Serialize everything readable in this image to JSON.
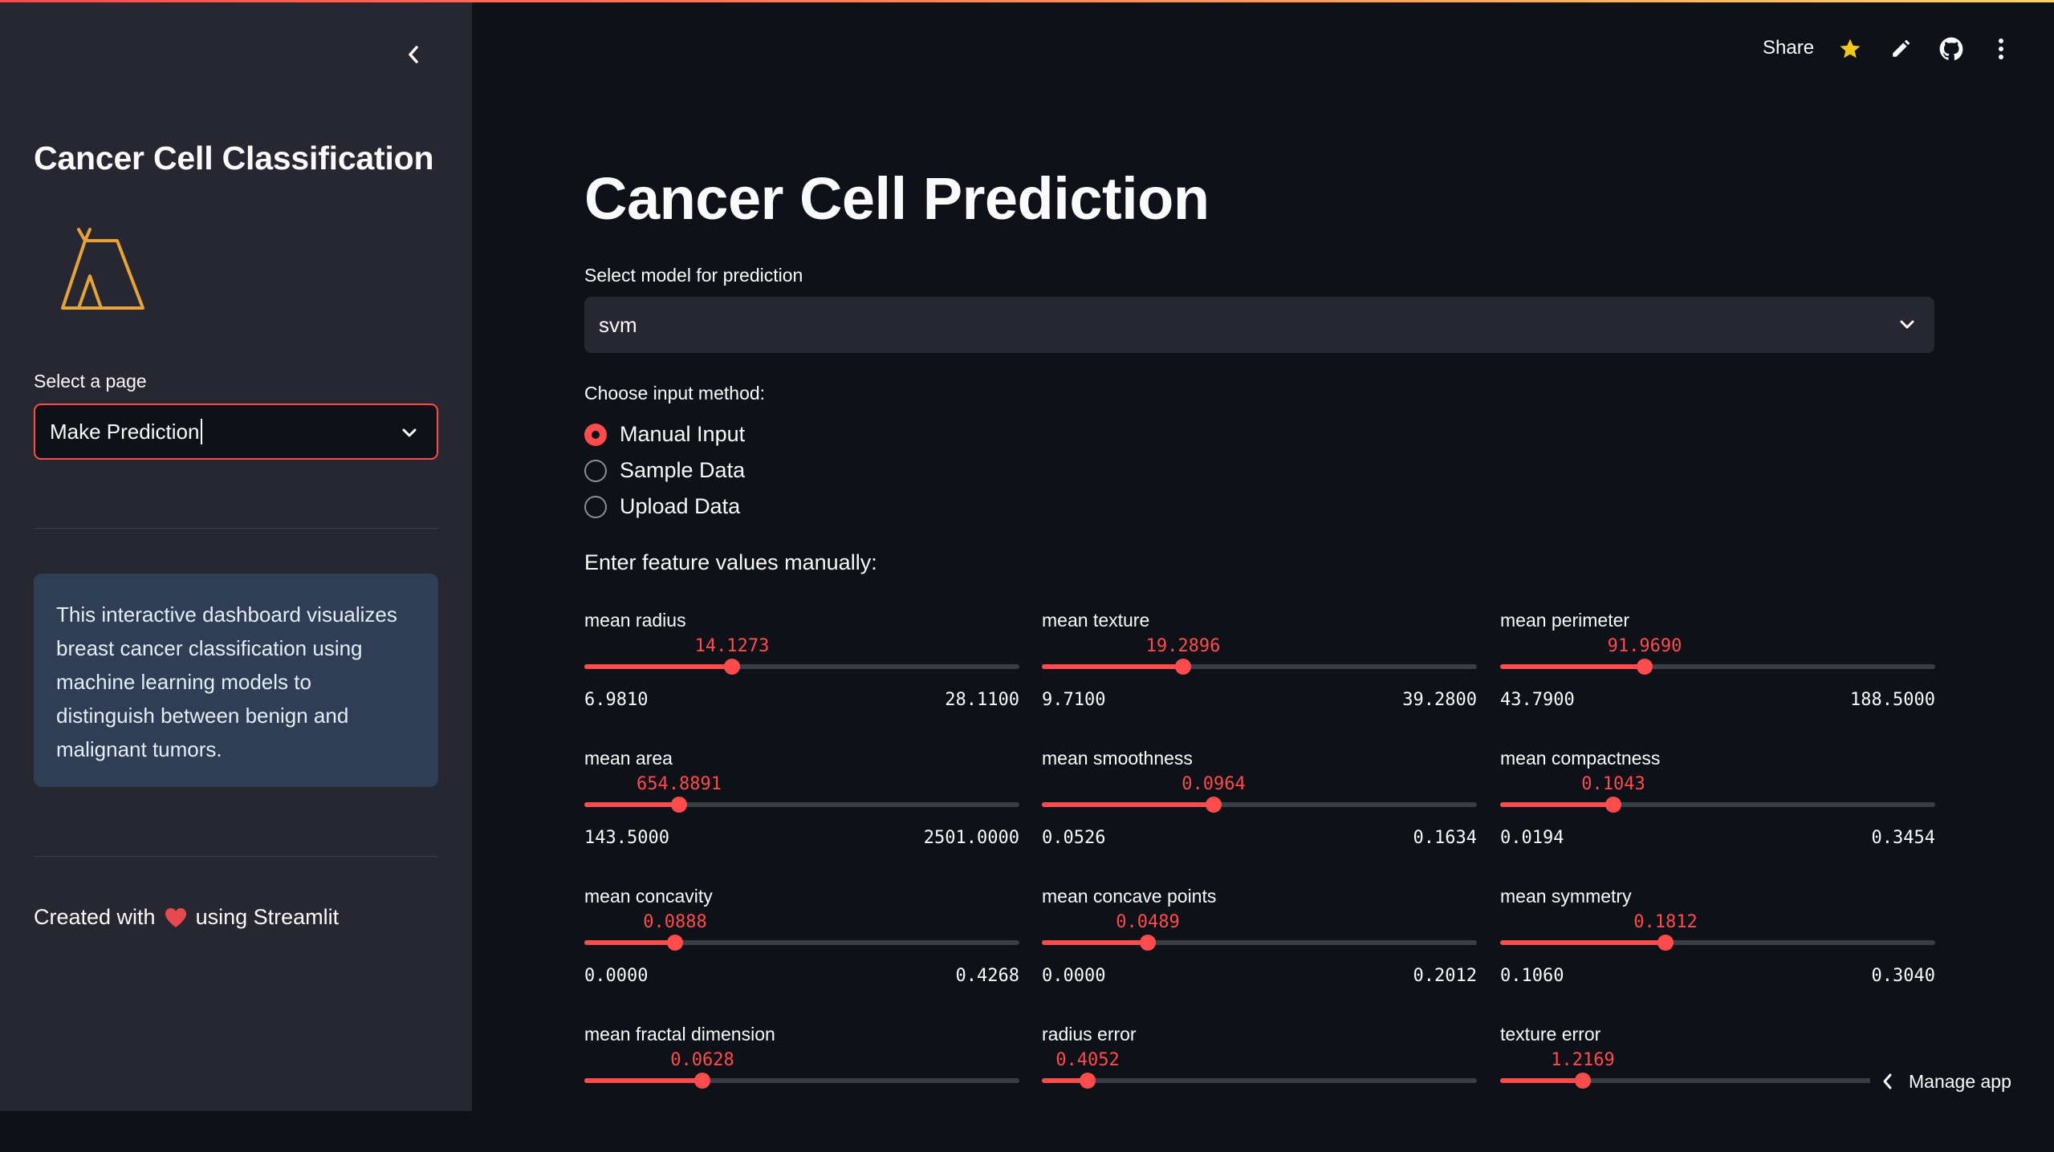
{
  "sidebar": {
    "title": "Cancer Cell Classification",
    "select_label": "Select a page",
    "select_value": "Make Prediction",
    "info": "This interactive dashboard visualizes breast cancer classification using machine learning models to distinguish between benign and malignant tumors.",
    "footer_prefix": "Created with",
    "footer_suffix": "using Streamlit"
  },
  "toolbar": {
    "share_label": "Share"
  },
  "main": {
    "title": "Cancer Cell Prediction",
    "model_label": "Select model for prediction",
    "model_value": "svm",
    "input_method_label": "Choose input method:",
    "radio_options": [
      "Manual Input",
      "Sample Data",
      "Upload Data"
    ],
    "radio_selected": "Manual Input",
    "manual_header": "Enter feature values manually:"
  },
  "sliders": [
    {
      "label": "mean radius",
      "value": "14.1273",
      "min": "6.9810",
      "max": "28.1100",
      "fraction": 0.339
    },
    {
      "label": "mean texture",
      "value": "19.2896",
      "min": "9.7100",
      "max": "39.2800",
      "fraction": 0.324
    },
    {
      "label": "mean perimeter",
      "value": "91.9690",
      "min": "43.7900",
      "max": "188.5000",
      "fraction": 0.333
    },
    {
      "label": "mean area",
      "value": "654.8891",
      "min": "143.5000",
      "max": "2501.0000",
      "fraction": 0.217
    },
    {
      "label": "mean smoothness",
      "value": "0.0964",
      "min": "0.0526",
      "max": "0.1634",
      "fraction": 0.395
    },
    {
      "label": "mean compactness",
      "value": "0.1043",
      "min": "0.0194",
      "max": "0.3454",
      "fraction": 0.26
    },
    {
      "label": "mean concavity",
      "value": "0.0888",
      "min": "0.0000",
      "max": "0.4268",
      "fraction": 0.208
    },
    {
      "label": "mean concave points",
      "value": "0.0489",
      "min": "0.0000",
      "max": "0.2012",
      "fraction": 0.243
    },
    {
      "label": "mean symmetry",
      "value": "0.1812",
      "min": "0.1060",
      "max": "0.3040",
      "fraction": 0.38
    },
    {
      "label": "mean fractal dimension",
      "value": "0.0628",
      "min": "",
      "max": "",
      "fraction": 0.272
    },
    {
      "label": "radius error",
      "value": "0.4052",
      "min": "",
      "max": "",
      "fraction": 0.106
    },
    {
      "label": "texture error",
      "value": "1.2169",
      "min": "",
      "max": "",
      "fraction": 0.19
    }
  ],
  "manage_app": "Manage app",
  "colors": {
    "accent": "#ff4b4b",
    "background": "#0e1117",
    "sidebar": "#262730",
    "info_box": "#2f3e55"
  },
  "icons": [
    "chevron-left-icon",
    "tipi-logo-icon",
    "chevron-down-icon",
    "star-icon",
    "pencil-icon",
    "github-icon",
    "more-vertical-icon",
    "heart-icon"
  ]
}
